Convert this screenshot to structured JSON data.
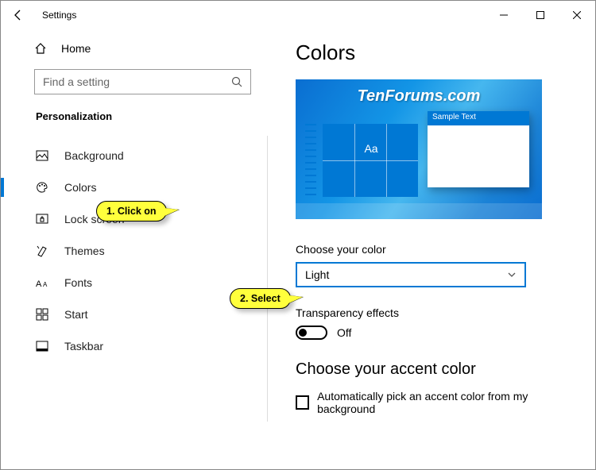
{
  "window": {
    "title": "Settings"
  },
  "home": {
    "label": "Home"
  },
  "search": {
    "placeholder": "Find a setting"
  },
  "category": "Personalization",
  "sidebar": {
    "items": [
      {
        "label": "Background"
      },
      {
        "label": "Colors"
      },
      {
        "label": "Lock screen"
      },
      {
        "label": "Themes"
      },
      {
        "label": "Fonts"
      },
      {
        "label": "Start"
      },
      {
        "label": "Taskbar"
      }
    ]
  },
  "page": {
    "title": "Colors",
    "watermark": "TenForums.com",
    "preview_sample_text": "Sample Text",
    "preview_aa": "Aa",
    "color_label": "Choose your color",
    "color_value": "Light",
    "transparency_label": "Transparency effects",
    "transparency_value": "Off",
    "accent_title": "Choose your accent color",
    "auto_accent_label": "Automatically pick an accent color from my background"
  },
  "callouts": {
    "c1": "1. Click on",
    "c2": "2. Select"
  }
}
